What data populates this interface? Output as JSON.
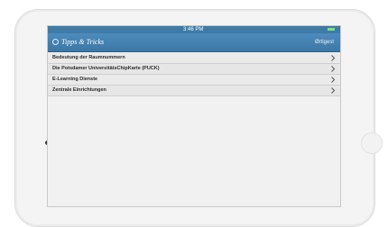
{
  "status": {
    "time": "3:46 PM"
  },
  "nav": {
    "title": "Tipps & Tricks",
    "action": "Ørtigest"
  },
  "list": {
    "items": [
      {
        "label": "Bedeutung der Raumnummern"
      },
      {
        "label": "Die Potsdamer UniversitätsChipKarte (PUCK)"
      },
      {
        "label": "E-Learning Dienste"
      },
      {
        "label": "Zentrale Einrichtungen"
      }
    ]
  },
  "colors": {
    "nav_bar": "#3c78a6",
    "row_background": "#e6e6e6",
    "battery": "#7fe07a"
  },
  "icons": {
    "row_chevron": "chevron-right-icon",
    "nav_back": "back-circle-icon"
  }
}
